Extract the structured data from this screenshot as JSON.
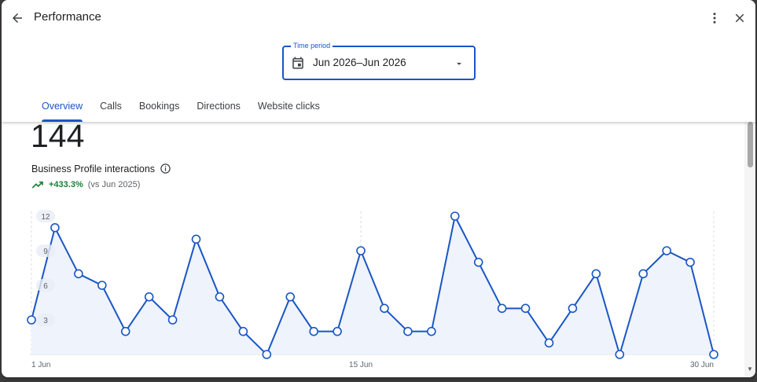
{
  "header": {
    "title": "Performance",
    "back_icon": "arrow-back-icon",
    "more_icon": "more-vert-icon",
    "close_icon": "close-icon"
  },
  "time_period": {
    "label": "Time period",
    "value": "Jun 2026–Jun 2026",
    "icon": "calendar-icon"
  },
  "tabs": [
    {
      "label": "Overview",
      "active": true
    },
    {
      "label": "Calls"
    },
    {
      "label": "Bookings"
    },
    {
      "label": "Directions"
    },
    {
      "label": "Website clicks"
    }
  ],
  "summary": {
    "total": "144",
    "label": "Business Profile interactions",
    "change": "+433.3%",
    "comparison": "(vs Jun 2025)"
  },
  "colors": {
    "accent": "#1a56c4",
    "positive": "#188038"
  },
  "chart_data": {
    "type": "area",
    "x": [
      1,
      2,
      3,
      4,
      5,
      6,
      7,
      8,
      9,
      10,
      11,
      12,
      13,
      14,
      15,
      16,
      17,
      18,
      19,
      20,
      21,
      22,
      23,
      24,
      25,
      26,
      27,
      28,
      29,
      30
    ],
    "values": [
      3,
      11,
      7,
      6,
      2,
      5,
      3,
      10,
      5,
      2,
      0,
      5,
      2,
      2,
      9,
      4,
      2,
      2,
      12,
      8,
      4,
      4,
      1,
      4,
      7,
      0,
      7,
      9,
      8,
      0
    ],
    "y_ticks": [
      "3",
      "6",
      "9",
      "12"
    ],
    "x_ticks": [
      {
        "day": 1,
        "label": "1 Jun"
      },
      {
        "day": 15,
        "label": "15 Jun"
      },
      {
        "day": 30,
        "label": "30 Jun"
      }
    ],
    "ylim": [
      0,
      12
    ]
  }
}
